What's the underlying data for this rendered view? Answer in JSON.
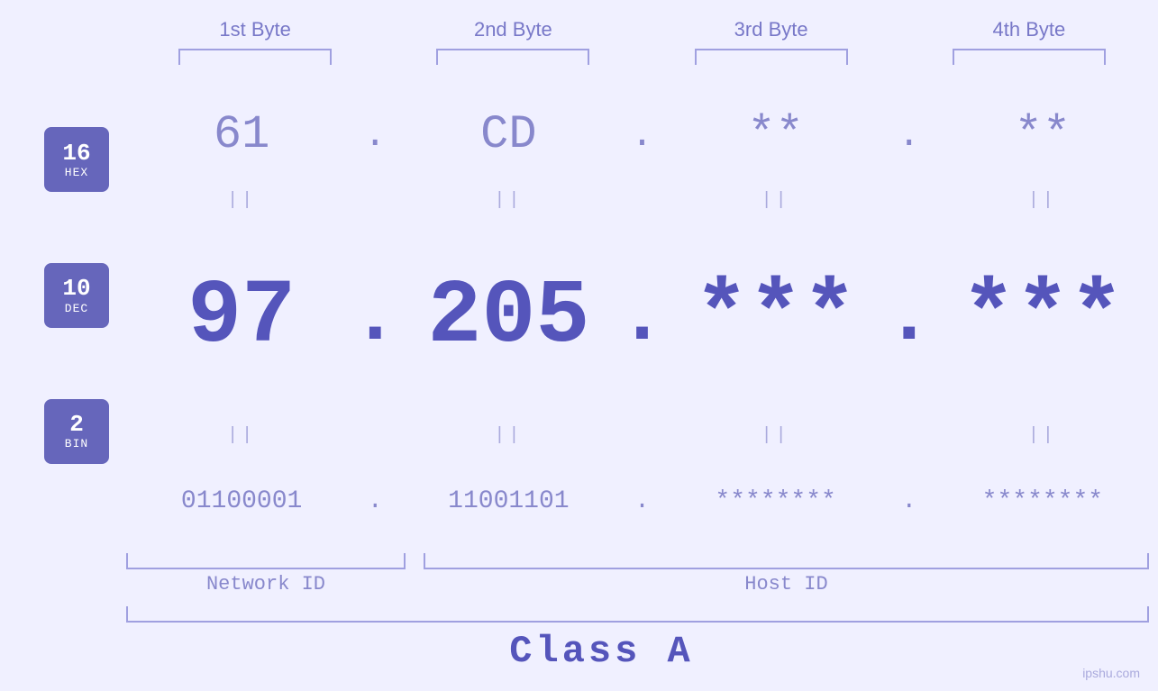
{
  "header": {
    "byte1": "1st Byte",
    "byte2": "2nd Byte",
    "byte3": "3rd Byte",
    "byte4": "4th Byte"
  },
  "badges": {
    "hex": {
      "number": "16",
      "label": "HEX"
    },
    "dec": {
      "number": "10",
      "label": "DEC"
    },
    "bin": {
      "number": "2",
      "label": "BIN"
    }
  },
  "hex_row": {
    "val1": "61",
    "dot1": ".",
    "val2": "CD",
    "dot2": ".",
    "val3": "**",
    "dot3": ".",
    "val4": "**"
  },
  "dec_row": {
    "val1": "97",
    "dot1": ".",
    "val2": "205",
    "dot2": ".",
    "val3": "***",
    "dot3": ".",
    "val4": "***"
  },
  "bin_row": {
    "val1": "01100001",
    "dot1": ".",
    "val2": "11001101",
    "dot2": ".",
    "val3": "********",
    "dot3": ".",
    "val4": "********"
  },
  "separators": {
    "sym": "||"
  },
  "bottom": {
    "network_id": "Network ID",
    "host_id": "Host ID",
    "class": "Class A"
  },
  "watermark": "ipshu.com"
}
